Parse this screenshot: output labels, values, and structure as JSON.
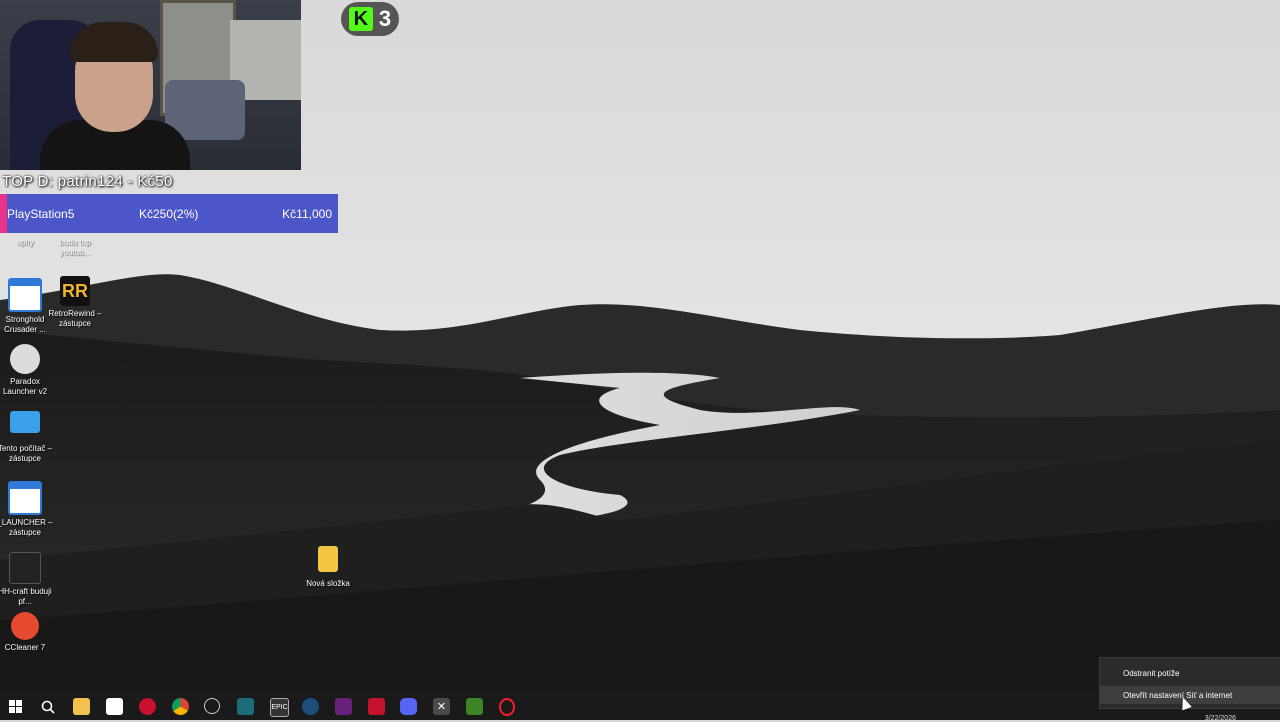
{
  "overlay": {
    "top_donor": "TOP D: patrin124 - Kč50",
    "goal": {
      "name": "PlayStation5",
      "progress_text": "Kč250(2%)",
      "target": "Kč11,000",
      "progress": 0.02
    },
    "kick": {
      "logo": "K",
      "count": "3"
    }
  },
  "desktop": {
    "icons": [
      {
        "label": "aplty",
        "icon": "app-icon"
      },
      {
        "label": "budu top youtub...",
        "icon": "video-icon"
      },
      {
        "label": "Stronghold Crusader ...",
        "icon": "shortcut-window-icon"
      },
      {
        "label": "RetroRewind – zástupce",
        "icon": "rr-logo-icon"
      },
      {
        "label": "Paradox Launcher v2",
        "icon": "paradox-icon"
      },
      {
        "label": "Tento počítač – zástupce",
        "icon": "computer-icon"
      },
      {
        "label": "_LAUNCHER – zástupce",
        "icon": "shortcut-window-icon"
      },
      {
        "label": "HH-craft buduji pf...",
        "icon": "video-thumb-icon"
      },
      {
        "label": "CCleaner 7",
        "icon": "ccleaner-icon"
      },
      {
        "label": "Nová složka",
        "icon": "folder-icon"
      }
    ]
  },
  "taskbar": {
    "icons": [
      "windows-start-icon",
      "search-icon",
      "file-explorer-icon",
      "store-icon",
      "app-red-icon",
      "chrome-icon",
      "obs-icon",
      "app-teal-icon",
      "epic-games-icon",
      "steam-icon",
      "visual-studio-icon",
      "app-red2-icon",
      "discord-icon",
      "app-cross-icon",
      "minecraft-icon",
      "opera-icon"
    ],
    "clock_date": "3/22/2026"
  },
  "context_menu": {
    "items": [
      {
        "label": "Odstranit potíže"
      },
      {
        "label": "Otevřít nastavení Síť a internet"
      }
    ]
  },
  "colors": {
    "goal_bar": "#4c56c9",
    "goal_fill": "#e8358b",
    "kick_green": "#53fc18",
    "taskbar": "#1a1a1a",
    "menu_bg": "#2b2b2b"
  }
}
